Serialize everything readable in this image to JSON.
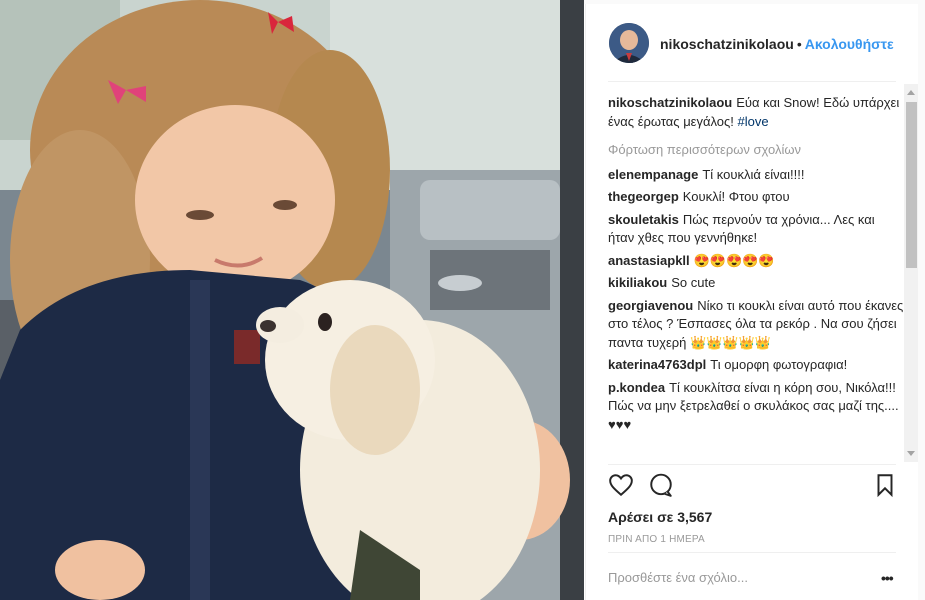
{
  "header": {
    "username": "nikoschatzinikolaou",
    "dot": "•",
    "follow_label": "Ακολουθήστε"
  },
  "caption": {
    "username": "nikoschatzinikolaou",
    "text": "Εύα και Snow! Εδώ υπάρχει ένας έρωτας μεγάλος!",
    "hashtag": "#love"
  },
  "load_more": "Φόρτωση περισσότερων σχολίων",
  "comments": [
    {
      "user": "elenempanage",
      "text": "Τί κουκλιά είναι!!!!"
    },
    {
      "user": "thegeorgep",
      "text": "Κουκλί! Φτου φτου"
    },
    {
      "user": "skouletakis",
      "text": "Πώς περνούν τα χρόνια... Λες και ήταν χθες που γεννήθηκε!"
    },
    {
      "user": "anastasiapkll",
      "text": "😍😍😍😍😍"
    },
    {
      "user": "kikiliakou",
      "text": "So cute"
    },
    {
      "user": "georgiavenou",
      "text": "Νίκο τι κουκλι είναι αυτό που έκανες στο τέλος ? Έσπασες όλα τα ρεκόρ . Να σου ζήσει παντα τυχερή 👑👑👑👑👑"
    },
    {
      "user": "katerina4763dpl",
      "text": "Τι ομορφη φωτογραφια!"
    },
    {
      "user": "p.kondea",
      "text": "Τί κουκλίτσα είναι η κόρη σου, Νικόλα!!! Πώς να μην ξετρελαθεί ο σκυλάκος σας μαζί της.... ♥♥♥"
    }
  ],
  "likes": "Αρέσει σε 3,567",
  "time_ago": "ΠΡΙΝ ΑΠΟ 1 ΗΜΕΡΑ",
  "add_comment_placeholder": "Προσθέστε ένα σχόλιο...",
  "options": "•••",
  "icons": {
    "like": "heart-icon",
    "comment": "comment-icon",
    "save": "bookmark-icon"
  },
  "colors": {
    "link": "#3897f0",
    "hashtag": "#003569",
    "text": "#262626",
    "muted": "#999999"
  }
}
